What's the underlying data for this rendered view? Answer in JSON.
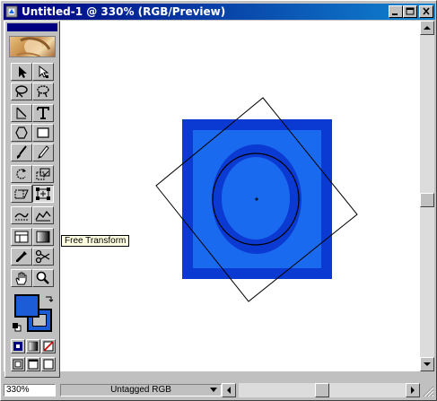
{
  "window": {
    "title": "Untitled-1 @ 330% (RGB/Preview)",
    "buttons": [
      "minimize-icon",
      "maximize-icon",
      "close-icon"
    ]
  },
  "toolbox": {
    "tools": [
      {
        "name": "move-tool-icon"
      },
      {
        "name": "direct-selection-tool-icon"
      },
      {
        "name": "lasso-tool-icon"
      },
      {
        "name": "magic-lasso-tool-icon"
      },
      {
        "name": "line-tool-icon"
      },
      {
        "name": "type-tool-icon"
      },
      {
        "name": "polygon-tool-icon"
      },
      {
        "name": "rectangle-tool-icon"
      },
      {
        "name": "brush-tool-icon"
      },
      {
        "name": "pencil-tool-icon"
      },
      {
        "name": "rotate-tool-icon"
      },
      {
        "name": "scale-tool-icon"
      },
      {
        "name": "skew-tool-icon"
      },
      {
        "name": "free-transform-tool-icon"
      },
      {
        "name": "warp-tool-icon"
      },
      {
        "name": "reshape-tool-icon"
      },
      {
        "name": "gradient-tool-icon"
      },
      {
        "name": "blend-tool-icon"
      },
      {
        "name": "eyedropper-tool-icon"
      },
      {
        "name": "scissors-tool-icon"
      },
      {
        "name": "hand-tool-icon"
      },
      {
        "name": "zoom-tool-icon"
      }
    ],
    "tooltip": "Free Transform",
    "colors": {
      "foreground": "#1c5cd6",
      "background": "#c0c0c0"
    },
    "view_modes": [
      "color-mode-icon",
      "gradient-mode-icon",
      "none-mode-icon"
    ],
    "screen_modes": [
      "standard-screen-icon",
      "full-screen-menu-icon",
      "full-screen-icon"
    ]
  },
  "canvas": {
    "colors": {
      "outer": "#0a3ad2",
      "inner": "#1a6af0",
      "ellipse": "#0a3ad2",
      "ellipse_inner": "#1a6af0"
    }
  },
  "statusbar": {
    "zoom": "330%",
    "profile": "Untagged RGB"
  }
}
